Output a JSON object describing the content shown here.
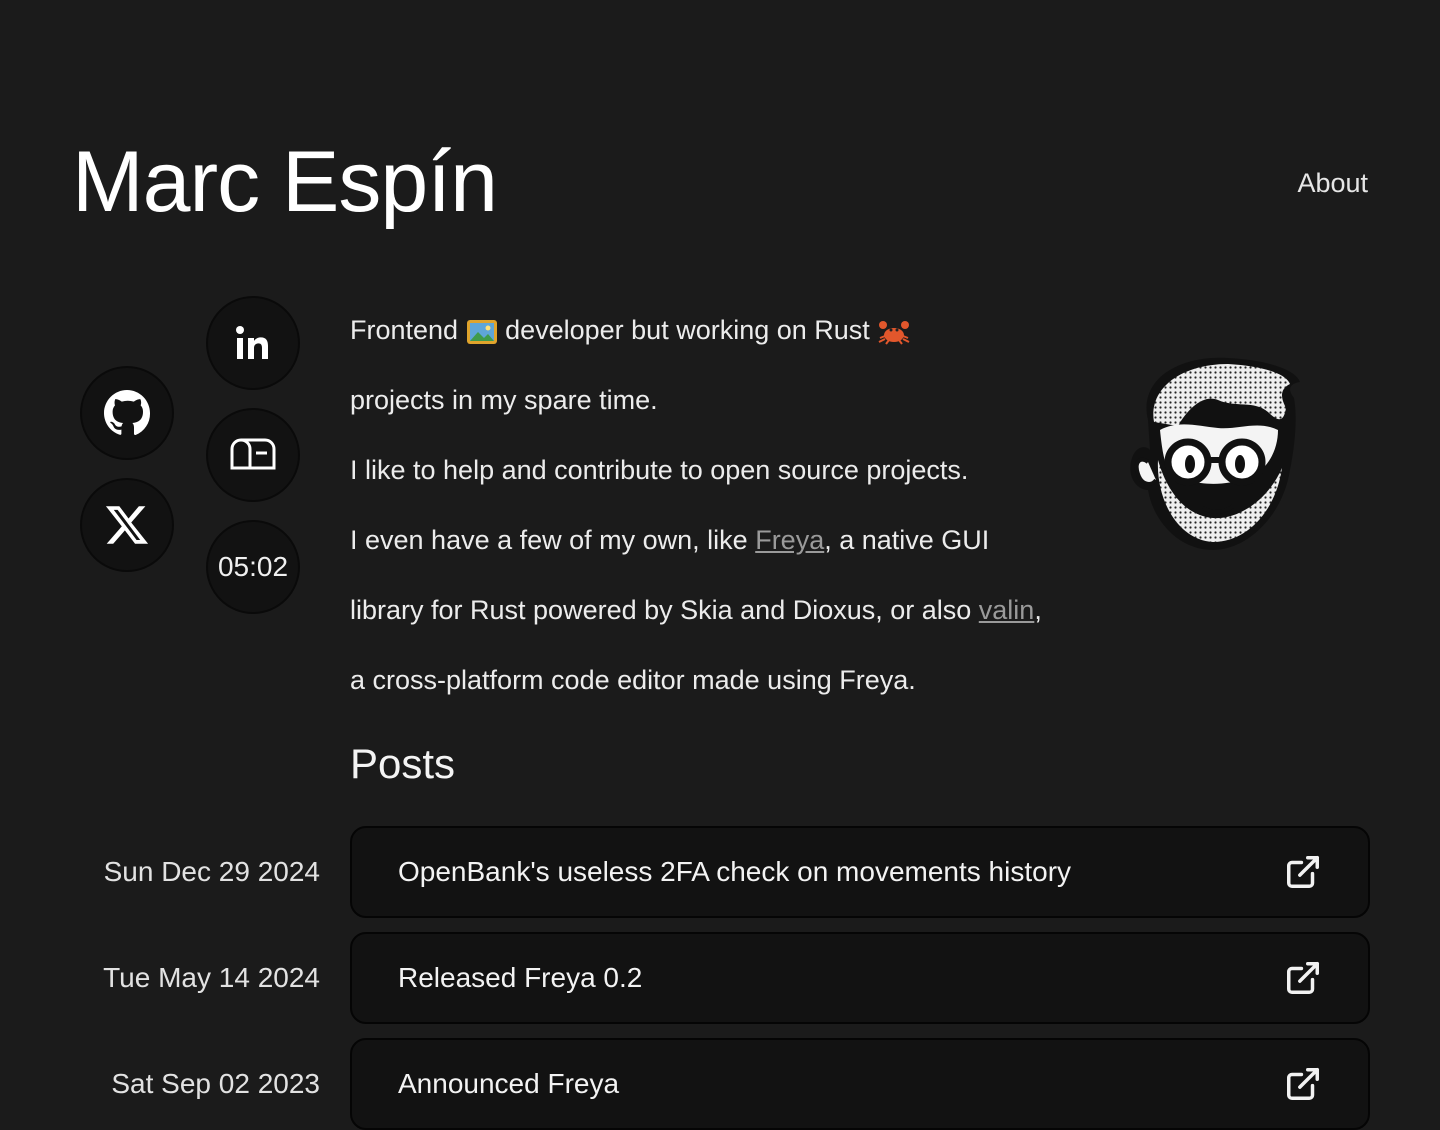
{
  "header": {
    "title": "Marc Espín",
    "nav_about": "About"
  },
  "social": {
    "linkedin_icon": "linkedin-icon",
    "github_icon": "github-icon",
    "x_icon": "x-icon",
    "mailbox_icon": "mailbox-icon",
    "clock_time": "05:02"
  },
  "bio": {
    "line1_a": "Frontend ",
    "line1_b": " developer but working on Rust ",
    "line1_c": "projects in my spare time.",
    "line2": "I like to help and contribute to open source projects.",
    "line3_a": "I even have a few of my own, like ",
    "freya_link": "Freya",
    "line3_b": ", a native GUI library for Rust powered by Skia and Dioxus, or also ",
    "valin_link": "valin",
    "line3_c": ", a cross-platform code editor made using Freya."
  },
  "posts": {
    "heading": "Posts",
    "items": [
      {
        "date": "Sun Dec 29 2024",
        "title": "OpenBank's useless 2FA check on movements history"
      },
      {
        "date": "Tue May 14 2024",
        "title": "Released Freya 0.2"
      },
      {
        "date": "Sat Sep 02 2023",
        "title": "Announced Freya"
      }
    ]
  },
  "colors": {
    "background": "#1b1b1b",
    "card": "#121212",
    "link": "#9a9a9a"
  }
}
